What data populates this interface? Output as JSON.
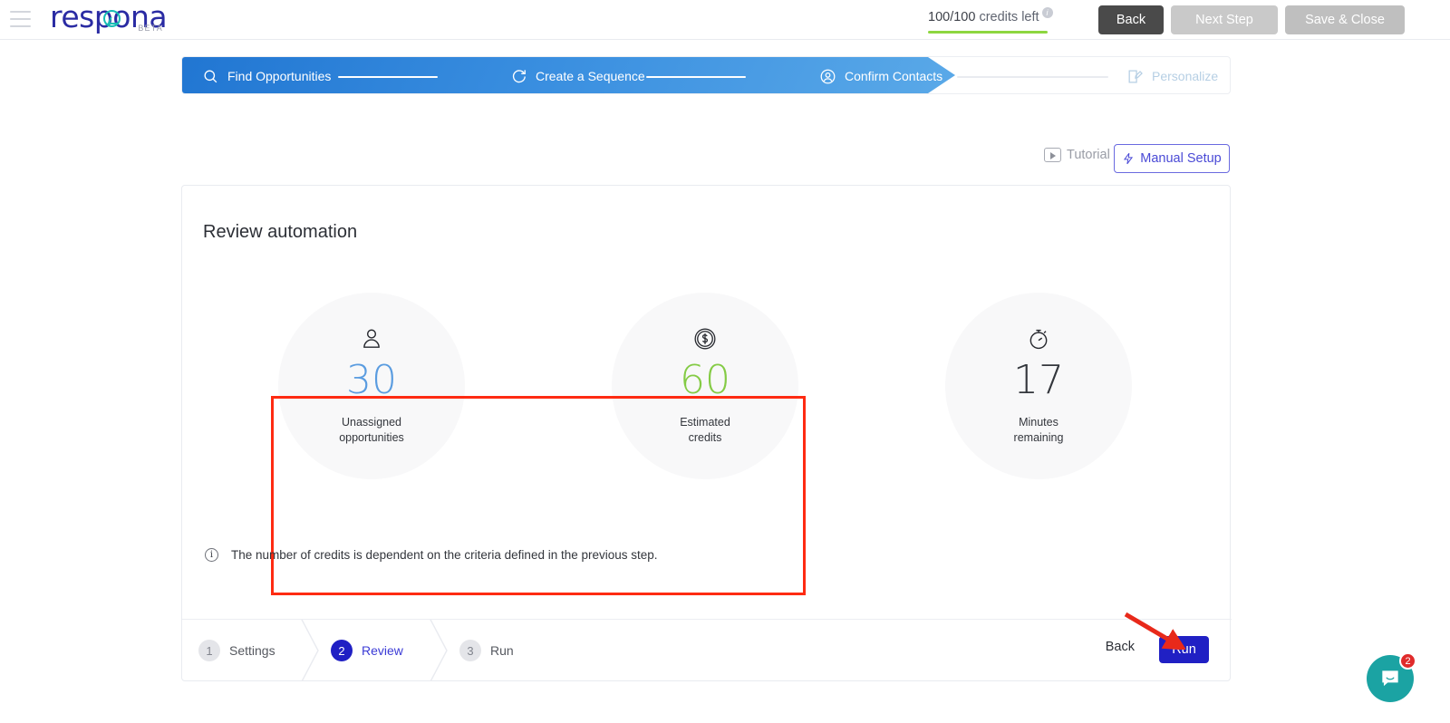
{
  "topbar": {
    "menu_icon": "hamburger-icon",
    "logo_text": "respona",
    "logo_beta": "BETA",
    "credits": {
      "value": "100/100",
      "label": "credits left",
      "info_icon": "info-icon",
      "bar_color": "#8dd63f",
      "percent": 100
    },
    "buttons": {
      "back": "Back",
      "next_step": "Next Step",
      "save_close": "Save & Close"
    }
  },
  "stepper": {
    "items": [
      {
        "label": "Find Opportunities",
        "icon": "search-icon",
        "state": "done"
      },
      {
        "label": "Create a Sequence",
        "icon": "refresh-icon",
        "state": "done"
      },
      {
        "label": "Confirm Contacts",
        "icon": "user-circle-icon",
        "state": "current"
      },
      {
        "label": "Personalize",
        "icon": "edit-icon",
        "state": "upcoming"
      }
    ]
  },
  "toolbar": {
    "tutorial_label": "Tutorial",
    "tutorial_icon": "play-icon",
    "manual_setup_label": "Manual Setup",
    "manual_setup_icon": "lightning-icon"
  },
  "card": {
    "title": "Review automation",
    "stats": [
      {
        "value": "30",
        "label_line1": "Unassigned",
        "label_line2": "opportunities",
        "icon": "person-icon",
        "color": "#5a9ce0"
      },
      {
        "value": "60",
        "label_line1": "Estimated",
        "label_line2": "credits",
        "icon": "coin-dollar-icon",
        "color": "#84cb45"
      },
      {
        "value": "17",
        "label_line1": "Minutes",
        "label_line2": "remaining",
        "icon": "stopwatch-icon",
        "color": "#33363c"
      }
    ],
    "note": {
      "icon": "info-icon",
      "text": "The number of credits is dependent on the criteria defined in the previous step."
    },
    "footer": {
      "wizard": [
        {
          "num": "1",
          "label": "Settings",
          "state": "idle"
        },
        {
          "num": "2",
          "label": "Review",
          "state": "active"
        },
        {
          "num": "3",
          "label": "Run",
          "state": "idle"
        }
      ],
      "back_label": "Back",
      "run_label": "Run"
    }
  },
  "annotations": {
    "highlight_color": "#fe2b12",
    "arrow_color": "#e8291a",
    "arrow_target": "run-button"
  },
  "chat": {
    "icon": "chat-bubble-icon",
    "unread": "2",
    "color": "#1ba3a3",
    "badge_color": "#e02b2b"
  }
}
